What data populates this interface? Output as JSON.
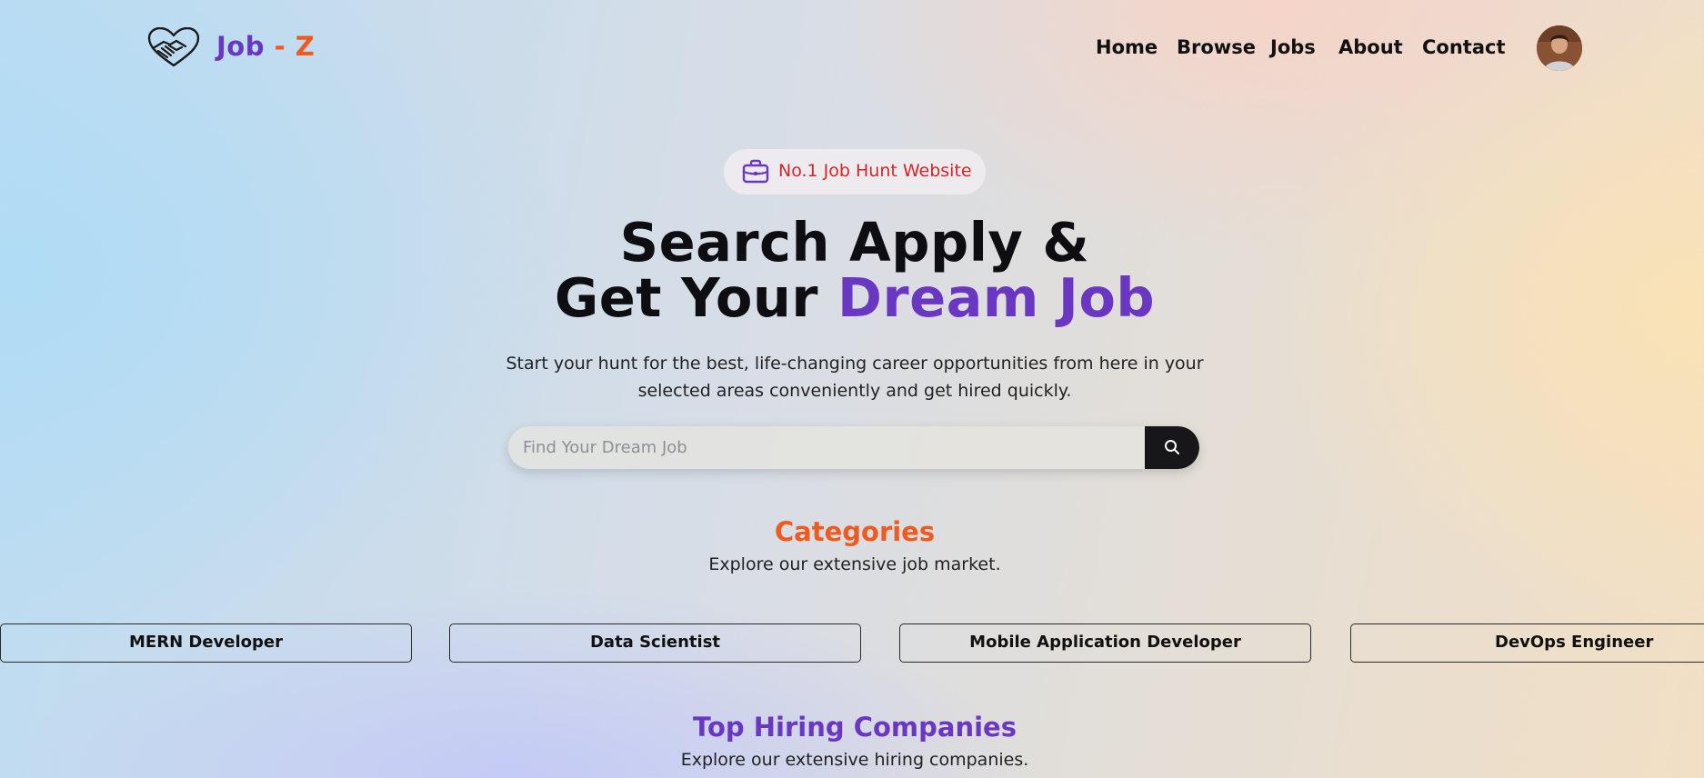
{
  "header": {
    "logo": {
      "part1": "Job",
      "separator": " - ",
      "part2": "Z"
    },
    "nav": [
      {
        "label": "Home"
      },
      {
        "label": "Browse"
      },
      {
        "label": "Jobs"
      },
      {
        "label": "About"
      },
      {
        "label": "Contact"
      }
    ],
    "icons": {
      "logo": "handshake-heart-icon",
      "avatar": "user-avatar"
    }
  },
  "hero": {
    "badge": {
      "icon": "briefcase-icon",
      "text": "No.1 Job Hunt Website"
    },
    "headline_line1": "Search Apply &",
    "headline_line2_prefix": "Get Your ",
    "headline_line2_accent": "Dream Job",
    "subtitle_line1": "Start your hunt for the best, life-changing career opportunities from here in your",
    "subtitle_line2": "selected areas conveniently and get hired quickly.",
    "search": {
      "placeholder": "Find Your Dream Job",
      "value": "",
      "button_icon": "search-icon"
    }
  },
  "categories": {
    "title": "Categories",
    "subtitle": "Explore our extensive job market.",
    "items": [
      {
        "label": "MERN Developer"
      },
      {
        "label": "Data Scientist"
      },
      {
        "label": "Mobile Application Developer"
      },
      {
        "label": "DevOps Engineer"
      }
    ]
  },
  "companies": {
    "title": "Top Hiring Companies",
    "subtitle": "Explore our extensive hiring companies."
  },
  "colors": {
    "brand_purple": "#6a37c2",
    "brand_orange": "#f05a1e",
    "badge_red": "#d4252c",
    "search_button": "#17171a"
  }
}
